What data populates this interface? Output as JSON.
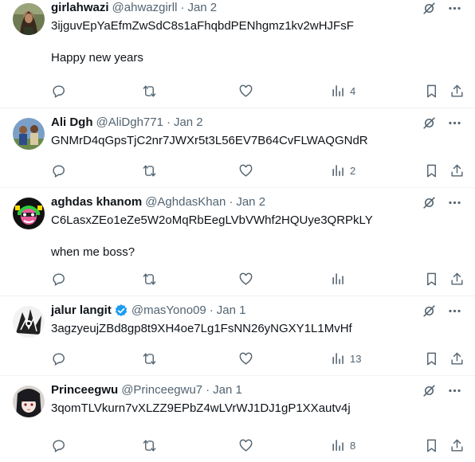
{
  "tweets": [
    {
      "name": "girlahwazi",
      "handle": "@ahwazgirll",
      "sep": "·",
      "date": "Jan 2",
      "verified": false,
      "text": "3ijguvEpYaEfmZwSdC8s1aFhqbdPENhgmz1kv2wHJFsF\n\nHappy new years",
      "views": "4",
      "avatar_icon": "photo-avatar"
    },
    {
      "name": "Ali Dgh",
      "handle": "@AliDgh771",
      "sep": "·",
      "date": "Jan 2",
      "verified": false,
      "text": "GNMrD4qGpsTjC2nr7JWXr5t3L56EV7B64CvFLWAQGNdR",
      "views": "2",
      "avatar_icon": "photo-avatar"
    },
    {
      "name": "aghdas khanom",
      "handle": "@AghdasKhan",
      "sep": "·",
      "date": "Jan 2",
      "verified": false,
      "text": "C6LasxZEo1eZe5W2oMqRbEegLVbVWhf2HQUye3QRPkLY\n\nwhen me boss?",
      "views": "",
      "avatar_icon": "cartoon-avatar"
    },
    {
      "name": "jalur langit",
      "handle": "@masYono09",
      "sep": "·",
      "date": "Jan 1",
      "verified": true,
      "text": "3agzyeujZBd8gp8t9XH4oe7Lg1FsNN26yNGXY1L1MvHf",
      "views": "13",
      "avatar_icon": "sketch-avatar"
    },
    {
      "name": "Princeegwu",
      "handle": "@Princeegwu7",
      "sep": "·",
      "date": "Jan 1",
      "verified": false,
      "text": "3qomTLVkurn7vXLZZ9EPbZ4wLVrWJ1DJ1gP1XXautv4j",
      "views": "8",
      "avatar_icon": "anime-avatar"
    }
  ],
  "colors": {
    "text_primary": "#0f1419",
    "text_secondary": "#536471",
    "divider": "#eff3f4",
    "verified": "#1d9bf0"
  },
  "icons": [
    "grok-icon",
    "more-icon",
    "reply-icon",
    "retweet-icon",
    "like-icon",
    "views-icon",
    "bookmark-icon",
    "share-icon",
    "verified-badge-icon"
  ]
}
